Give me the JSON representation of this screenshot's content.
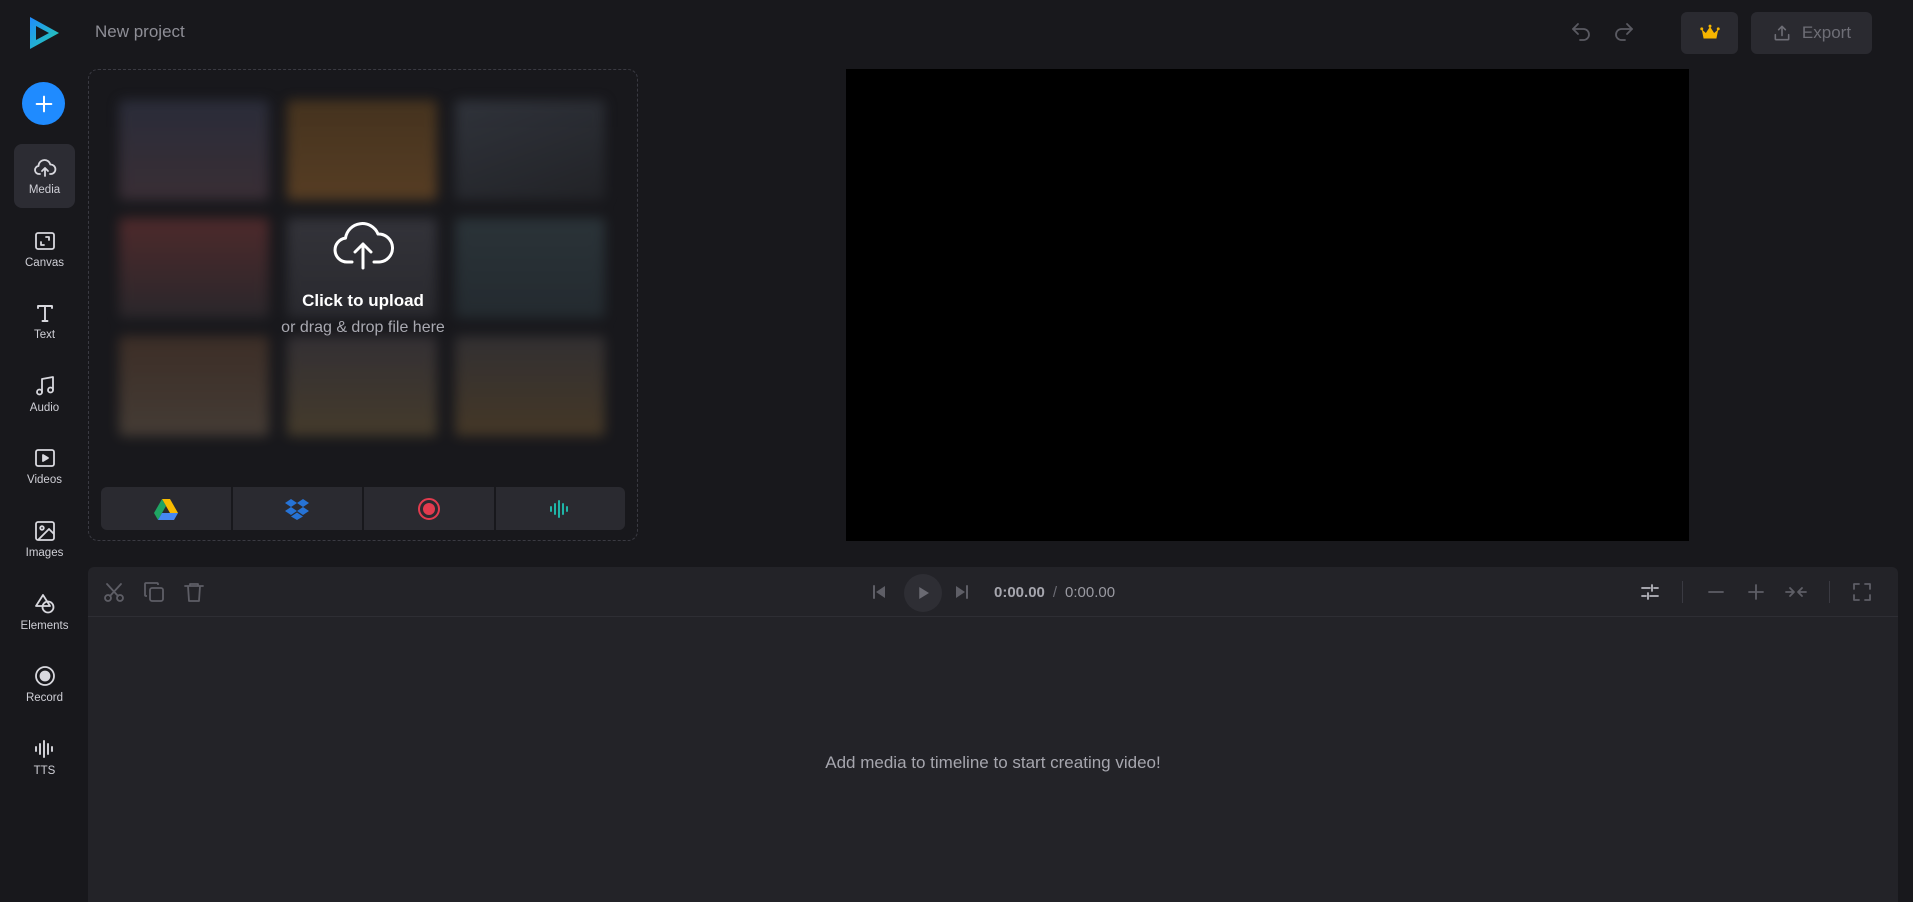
{
  "header": {
    "project_title": "New project",
    "export_label": "Export"
  },
  "sidebar": {
    "items": [
      {
        "label": "Media",
        "icon": "cloud-upload-icon",
        "active": true
      },
      {
        "label": "Canvas",
        "icon": "canvas-icon"
      },
      {
        "label": "Text",
        "icon": "text-icon"
      },
      {
        "label": "Audio",
        "icon": "music-note-icon"
      },
      {
        "label": "Videos",
        "icon": "video-icon"
      },
      {
        "label": "Images",
        "icon": "image-icon"
      },
      {
        "label": "Elements",
        "icon": "shapes-icon"
      },
      {
        "label": "Record",
        "icon": "record-icon"
      },
      {
        "label": "TTS",
        "icon": "waveform-icon"
      }
    ]
  },
  "upload": {
    "title": "Click to upload",
    "subtitle": "or drag & drop file here",
    "sources": [
      "google-drive-icon",
      "dropbox-icon",
      "record-icon",
      "waveform-icon"
    ]
  },
  "timeline": {
    "current_time": "0:00.00",
    "separator": "/",
    "total_time": "0:00.00",
    "empty_message": "Add media to timeline to start creating video!"
  },
  "colors": {
    "accent": "#1f8bff",
    "background": "#18181c",
    "panel": "#232328",
    "crown": "#f5b400",
    "record": "#e23b4e",
    "tts": "#1fb5a8"
  }
}
